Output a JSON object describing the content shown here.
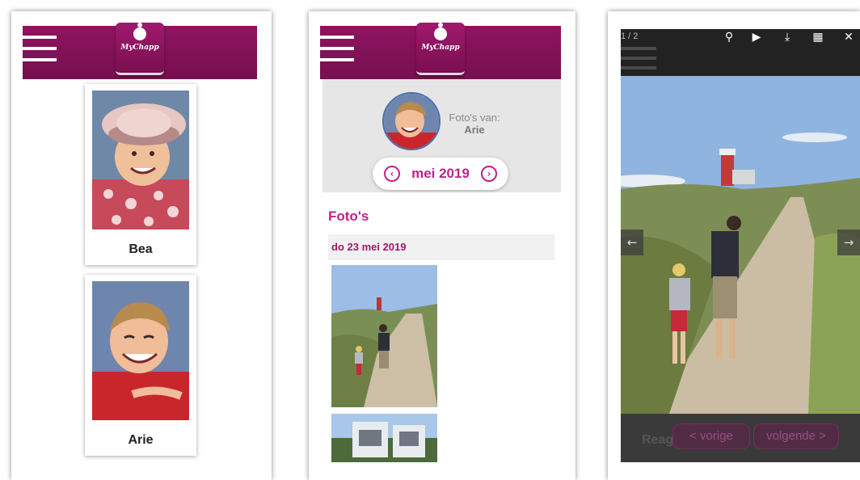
{
  "brand": {
    "logo_text": "MyChapp",
    "primary": "#86125a",
    "accent": "#c2218a"
  },
  "panel1": {
    "children": [
      {
        "name": "Bea"
      },
      {
        "name": "Arie"
      }
    ]
  },
  "panel2": {
    "fotos_van_label": "Foto's van:",
    "child_name": "Arie",
    "month_label": "mei 2019",
    "prev_icon": "chevron-left-circle-icon",
    "next_icon": "chevron-right-circle-icon",
    "section_title": "Foto's",
    "date_header": "do 23 mei 2019"
  },
  "panel3": {
    "counter": "1 / 2",
    "toolbar": [
      {
        "icon": "search-icon",
        "glyph": "⚲"
      },
      {
        "icon": "play-icon",
        "glyph": "▶"
      },
      {
        "icon": "download-icon",
        "glyph": "⤓"
      },
      {
        "icon": "grid-icon",
        "glyph": "▦"
      },
      {
        "icon": "close-icon",
        "glyph": "✕"
      }
    ],
    "prev_arrow": "←",
    "next_arrow": "→",
    "comment_partial": "Reag",
    "prev_button": "< vorige",
    "next_button": "volgende >"
  }
}
